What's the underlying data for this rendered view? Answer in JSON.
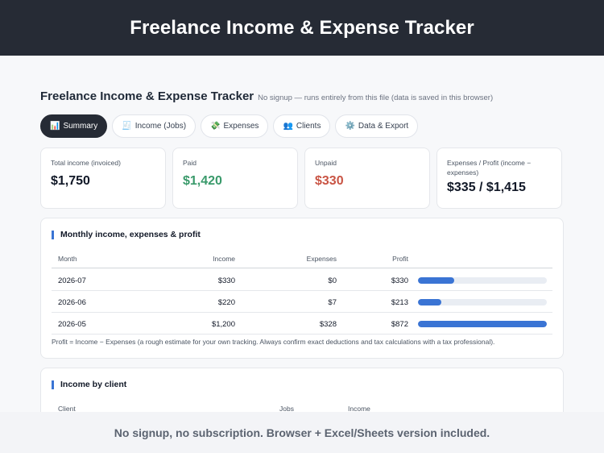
{
  "banner": {
    "title": "Freelance Income & Expense Tracker"
  },
  "app": {
    "title": "Freelance Income & Expense Tracker",
    "subtitle": "No signup — runs entirely from this file (data is saved in this browser)"
  },
  "tabs": [
    {
      "label": "Summary",
      "icon": "📊",
      "active": true
    },
    {
      "label": "Income (Jobs)",
      "icon": "🧾",
      "active": false
    },
    {
      "label": "Expenses",
      "icon": "💸",
      "active": false
    },
    {
      "label": "Clients",
      "icon": "👥",
      "active": false
    },
    {
      "label": "Data & Export",
      "icon": "⚙️",
      "active": false
    }
  ],
  "cards": [
    {
      "label": "Total income (invoiced)",
      "value": "$1,750"
    },
    {
      "label": "Paid",
      "value": "$1,420"
    },
    {
      "label": "Unpaid",
      "value": "$330"
    },
    {
      "label": "Expenses / Profit (income − expenses)",
      "value": "$335 / $1,415"
    }
  ],
  "monthly": {
    "title": "Monthly income, expenses & profit",
    "columns": {
      "month": "Month",
      "income": "Income",
      "expenses": "Expenses",
      "profit": "Profit"
    },
    "rows": [
      {
        "month": "2026-07",
        "income": "$330",
        "expenses": "$0",
        "profit": "$330",
        "profit_fraction": 0.28
      },
      {
        "month": "2026-06",
        "income": "$220",
        "expenses": "$7",
        "profit": "$213",
        "profit_fraction": 0.18
      },
      {
        "month": "2026-05",
        "income": "$1,200",
        "expenses": "$328",
        "profit": "$872",
        "profit_fraction": 1.0
      }
    ],
    "note": "Profit = Income − Expenses (a rough estimate for your own tracking. Always confirm exact deductions and tax calculations with a tax professional)."
  },
  "by_client": {
    "title": "Income by client",
    "columns": {
      "client": "Client",
      "jobs": "Jobs",
      "income": "Income"
    }
  },
  "footer": {
    "text": "No signup, no subscription. Browser + Excel/Sheets version included."
  },
  "colors": {
    "accent": "#3a74d4",
    "dark": "#262b35",
    "paid": "#3a9a6b",
    "unpaid": "#c95444"
  }
}
